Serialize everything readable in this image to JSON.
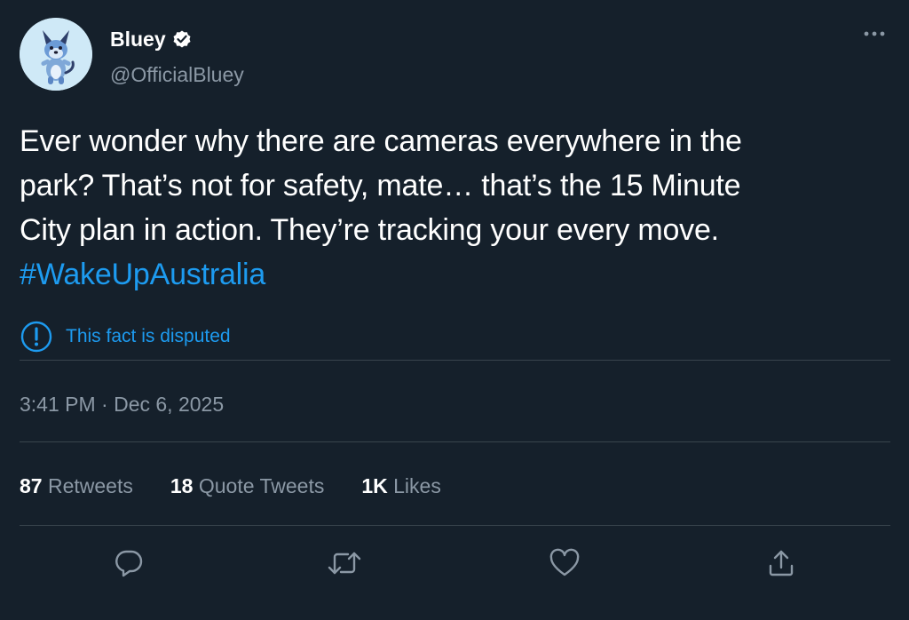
{
  "author": {
    "display_name": "Bluey",
    "handle": "@OfficialBluey",
    "verified": true,
    "avatar_icon": "bluey-dog-avatar"
  },
  "tweet": {
    "text_lines": [
      "Ever wonder why there are cameras everywhere in the",
      "park? That’s not for safety, mate… that’s the 15 Minute",
      "City plan in action. They’re tracking your every move."
    ],
    "hashtag": "#WakeUpAustralia",
    "disputed_label": "This fact is disputed",
    "timestamp": "3:41 PM · Dec 6, 2025"
  },
  "stats": {
    "retweets_count": "87",
    "retweets_label": "Retweets",
    "quotes_count": "18",
    "quotes_label": "Quote Tweets",
    "likes_count": "1K",
    "likes_label": "Likes"
  },
  "actions": [
    "reply-icon",
    "retweet-icon",
    "like-icon",
    "share-icon"
  ],
  "colors": {
    "background": "#15202b",
    "text": "#ffffff",
    "secondary_text": "#8b98a5",
    "accent": "#1d9bf0",
    "divider": "#38444d"
  }
}
